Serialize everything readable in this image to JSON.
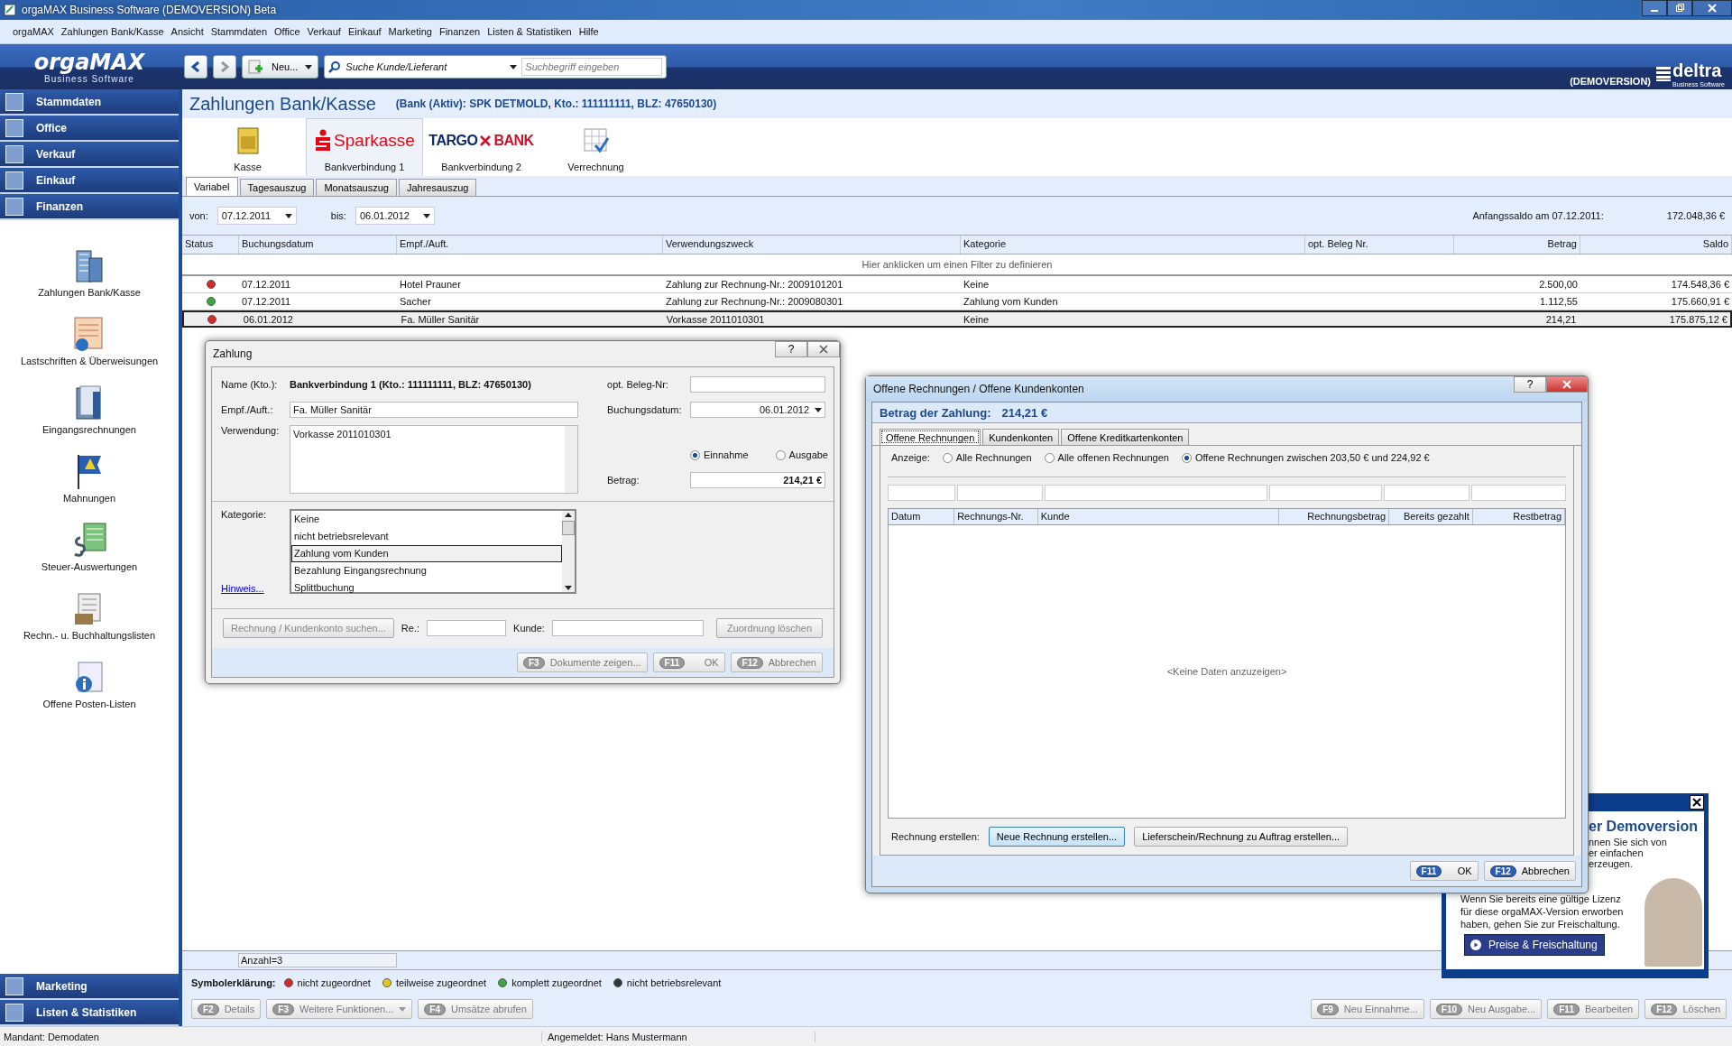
{
  "window": {
    "title": "orgaMAX Business Software (DEMOVERSION) Beta"
  },
  "menu": [
    "orgaMAX",
    "Zahlungen Bank/Kasse",
    "Ansicht",
    "Stammdaten",
    "Office",
    "Verkauf",
    "Einkauf",
    "Marketing",
    "Finanzen",
    "Listen & Statistiken",
    "Hilfe"
  ],
  "header": {
    "logo": "orgaMAX",
    "logo_subtitle": "Business Software",
    "new_button": "Neu...",
    "search_type": "Suche Kunde/Lieferant",
    "search": {
      "placeholder": "Suchbegriff eingeben"
    },
    "demo_label": "(DEMOVERSION)",
    "brand": "deltra",
    "brand_subtitle": "Business Software"
  },
  "sidebar": {
    "sections": [
      "Stammdaten",
      "Office",
      "Verkauf",
      "Einkauf",
      "Finanzen"
    ],
    "items": [
      "Zahlungen Bank/Kasse",
      "Lastschriften & Überweisungen",
      "Eingangsrechnungen",
      "Mahnungen",
      "Steuer-Auswertungen",
      "Rechn.- u. Buchhaltungslisten",
      "Offene Posten-Listen"
    ],
    "bottom_sections": [
      "Marketing",
      "Listen & Statistiken"
    ]
  },
  "page": {
    "title": "Zahlungen Bank/Kasse",
    "account": "(Bank (Aktiv): SPK DETMOLD, Kto.: 111111111, BLZ: 47650130)",
    "accounts": [
      {
        "kind": "kasse",
        "label": "Kasse",
        "selected": false
      },
      {
        "kind": "sparkasse",
        "logo": "Sparkasse",
        "label": "Bankverbindung 1",
        "selected": true
      },
      {
        "kind": "targo",
        "logo": "TARGO",
        "logo_2": "BANK",
        "label": "Bankverbindung 2",
        "selected": false
      },
      {
        "kind": "grid",
        "label": "Verrechnung",
        "selected": false
      }
    ],
    "period_tabs": [
      {
        "label": "Variabel",
        "selected": true
      },
      {
        "label": "Tagesauszug",
        "selected": false
      },
      {
        "label": "Monatsauszug",
        "selected": false
      },
      {
        "label": "Jahresauszug",
        "selected": false
      }
    ],
    "from_label": "von:",
    "from": "07.12.2011",
    "to_label": "bis:",
    "to": "06.01.2012",
    "opening_label": "Anfangssaldo am 07.12.2011:",
    "opening_balance": "172.048,36 €",
    "table": {
      "columns": [
        "Status",
        "Buchungsdatum",
        "Empf./Auft.",
        "Verwendungszweck",
        "Kategorie",
        "opt. Beleg Nr.",
        "Betrag",
        "Saldo"
      ],
      "filter_hint": "Hier anklicken um einen Filter zu definieren",
      "rows": [
        {
          "color": "#d62a2a",
          "date": "07.12.2011",
          "party": "Hotel Prauner",
          "purpose": "Zahlung zur Rechnung-Nr.: 2009101201",
          "category": "Keine",
          "amount": "2.500,00",
          "balance": "174.548,36 €",
          "selected": false
        },
        {
          "color": "#3aa83a",
          "date": "07.12.2011",
          "party": "Sacher",
          "purpose": "Zahlung zur Rechnung-Nr.: 2009080301",
          "category": "Zahlung vom Kunden",
          "amount": "1.112,55",
          "balance": "175.660,91 €",
          "selected": false
        },
        {
          "color": "#d62a2a",
          "date": "06.01.2012",
          "party": "Fa. Müller Sanitär",
          "purpose": "Vorkasse 2011010301",
          "category": "Keine",
          "amount": "214,21",
          "balance": "175.875,12 €",
          "selected": true
        }
      ]
    },
    "count": "Anzahl=3",
    "legend_title": "Symbolerklärung:",
    "legend": [
      {
        "label": "nicht zugeordnet",
        "color": "#d62a2a"
      },
      {
        "label": "teilweise zugeordnet",
        "color": "#e8c817"
      },
      {
        "label": "komplett zugeordnet",
        "color": "#3aa83a"
      },
      {
        "label": "nicht betriebsrelevant",
        "color": "#2b3a3a"
      }
    ],
    "left_buttons": [
      {
        "key": "F2",
        "label": "Details",
        "dropdown": false
      },
      {
        "key": "F3",
        "label": "Weitere Funktionen...",
        "dropdown": true
      },
      {
        "key": "F4",
        "label": "Umsätze abrufen",
        "dropdown": false
      }
    ],
    "right_buttons": [
      {
        "key": "F9",
        "label": "Neu Einnahme..."
      },
      {
        "key": "F10",
        "label": "Neu Ausgabe..."
      },
      {
        "key": "F11",
        "label": "Bearbeiten"
      },
      {
        "key": "F12",
        "label": "Löschen"
      }
    ]
  },
  "payment_dialog": {
    "title": "Zahlung",
    "help_button": "?",
    "name_label": "Name (Kto.):",
    "name": "Bankverbindung 1 (Kto.: 111111111, BLZ: 47650130)",
    "party_label": "Empf./Auft.:",
    "party": "Fa. Müller Sanitär",
    "purpose_label": "Verwendung:",
    "purpose": "Vorkasse 2011010301",
    "receipt_label": "opt. Beleg-Nr:",
    "date_label": "Buchungsdatum:",
    "date": "06.01.2012",
    "types": [
      {
        "label": "Einnahme",
        "selected": true
      },
      {
        "label": "Ausgabe",
        "selected": false
      }
    ],
    "amount_label": "Betrag:",
    "amount": "214,21 €",
    "category_label": "Kategorie:",
    "categories": [
      {
        "label": "Keine",
        "selected": false
      },
      {
        "label": "nicht betriebsrelevant",
        "selected": false
      },
      {
        "label": "Zahlung vom Kunden",
        "selected": true
      },
      {
        "label": "Bezahlung Eingangsrechnung",
        "selected": false
      },
      {
        "label": "Splittbuchung",
        "selected": false
      }
    ],
    "hint_link": "Hinweis...",
    "search_button": "Rechnung / Kundenkonto suchen...",
    "invoice_label": "Re.:",
    "customer_label": "Kunde:",
    "clear_button": "Zuordnung löschen",
    "buttons": [
      {
        "key": "F3",
        "label": "Dokumente zeigen..."
      },
      {
        "key": "F11",
        "label": "OK"
      },
      {
        "key": "F12",
        "label": "Abbrechen"
      }
    ]
  },
  "invoices_dialog": {
    "title": "Offene Rechnungen / Offene Kundenkonten",
    "help_button": "?",
    "amount_label": "Betrag der Zahlung:",
    "amount": "214,21 €",
    "tabs": [
      {
        "label": "Offene Rechnungen",
        "selected": true
      },
      {
        "label": "Kundenkonten",
        "selected": false
      },
      {
        "label": "Offene Kreditkartenkonten",
        "selected": false
      }
    ],
    "show_label": "Anzeige:",
    "show_options": [
      {
        "label": "Alle Rechnungen",
        "selected": false
      },
      {
        "label": "Alle offenen Rechnungen",
        "selected": false
      },
      {
        "label": "Offene Rechnungen zwischen 203,50 € und 224,92 €",
        "selected": true
      }
    ],
    "columns": [
      "Datum",
      "Rechnungs-Nr.",
      "Kunde",
      "Rechnungsbetrag",
      "Bereits gezahlt",
      "Restbetrag"
    ],
    "empty": "<Keine Daten anzuzeigen>",
    "create_label": "Rechnung erstellen:",
    "create_buttons": [
      "Neue Rechnung erstellen...",
      "Lieferschein/Rechnung zu Auftrag erstellen..."
    ],
    "buttons": [
      {
        "key": "F11",
        "label": "OK"
      },
      {
        "key": "F12",
        "label": "Abbrechen"
      }
    ]
  },
  "promo": {
    "heading": "er Demoversion",
    "lines": [
      "nnen Sie sich von",
      "er einfachen",
      "erzeugen."
    ],
    "text": "Wenn Sie bereits eine gültige Lizenz für diese orgaMAX-Version erworben haben, gehen Sie zur Freischaltung.",
    "button": "Preise & Freischaltung"
  },
  "status_bar": [
    "Mandant: Demodaten",
    "Angemeldet: Hans Mustermann"
  ]
}
